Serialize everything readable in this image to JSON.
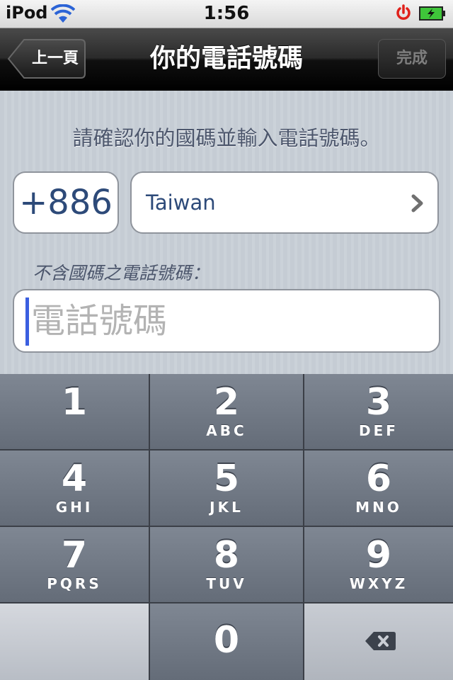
{
  "status_bar": {
    "carrier": "iPod",
    "time": "1:56",
    "wifi_icon": "wifi-icon",
    "power_icon": "power-icon",
    "battery_icon": "battery-charging-icon"
  },
  "nav": {
    "back_label": "上一頁",
    "title": "你的電話號碼",
    "done_label": "完成"
  },
  "content": {
    "instruction": "請確認你的國碼並輸入電話號碼。",
    "country_code": "+886",
    "country_name": "Taiwan",
    "phone_label": "不含國碼之電話號碼：",
    "phone_value": "",
    "phone_placeholder": "電話號碼"
  },
  "keypad": {
    "keys": [
      {
        "num": "1",
        "letters": ""
      },
      {
        "num": "2",
        "letters": "ABC"
      },
      {
        "num": "3",
        "letters": "DEF"
      },
      {
        "num": "4",
        "letters": "GHI"
      },
      {
        "num": "5",
        "letters": "JKL"
      },
      {
        "num": "6",
        "letters": "MNO"
      },
      {
        "num": "7",
        "letters": "PQRS"
      },
      {
        "num": "8",
        "letters": "TUV"
      },
      {
        "num": "9",
        "letters": "WXYZ"
      },
      {
        "num": "0",
        "letters": ""
      }
    ],
    "delete_icon": "backspace-icon"
  },
  "colors": {
    "accent_text": "#2d4a79",
    "cursor": "#3b5fe0"
  }
}
